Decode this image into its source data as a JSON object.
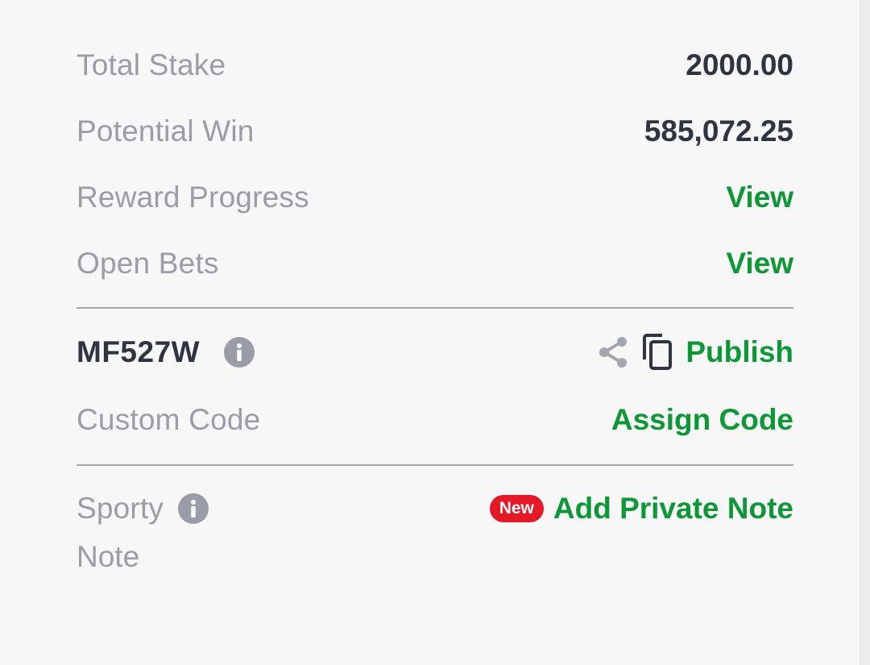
{
  "summary": {
    "total_stake_label": "Total Stake",
    "total_stake_value": "2000.00",
    "potential_win_label": "Potential Win",
    "potential_win_value": "585,072.25",
    "reward_progress_label": "Reward Progress",
    "reward_progress_link": "View",
    "open_bets_label": "Open Bets",
    "open_bets_link": "View"
  },
  "booking": {
    "code": "MF527W",
    "publish_label": "Publish",
    "custom_code_label": "Custom Code",
    "assign_code_label": "Assign Code"
  },
  "note": {
    "label_line1": "Sporty",
    "label_line2": "Note",
    "badge": "New",
    "add_note_label": "Add Private Note"
  },
  "icons": {
    "info": "info-icon",
    "share": "share-icon",
    "copy": "copy-icon"
  },
  "colors": {
    "accent_green": "#0d9737",
    "label_gray": "#9a9ca8",
    "value_dark": "#2f3442",
    "badge_red": "#e41827",
    "background": "#f7f7f8"
  }
}
